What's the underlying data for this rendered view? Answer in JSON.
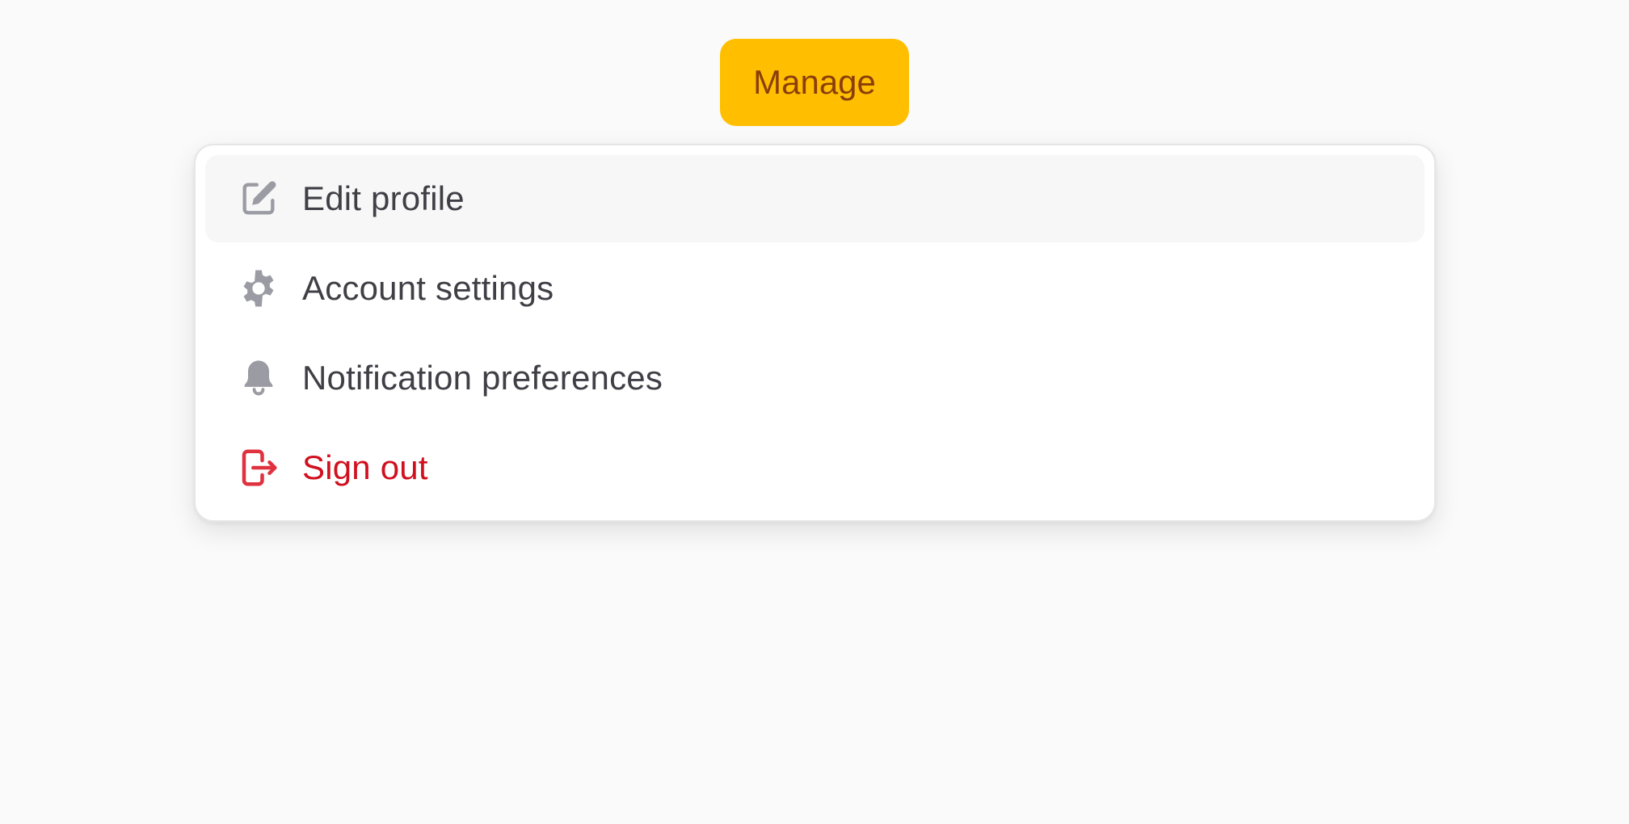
{
  "manage_button": {
    "label": "Manage",
    "color": "#ffbf00",
    "text_color": "#8a3f0a"
  },
  "menu": {
    "items": [
      {
        "label": "Edit profile",
        "icon": "edit-icon",
        "highlighted": true
      },
      {
        "label": "Account settings",
        "icon": "gear-icon",
        "highlighted": false
      },
      {
        "label": "Notification preferences",
        "icon": "bell-icon",
        "highlighted": false
      },
      {
        "label": "Sign out",
        "icon": "sign-out-icon",
        "highlighted": false,
        "danger": true
      }
    ],
    "icon_color": "#9b9ba3",
    "danger_color": "#d0101f"
  }
}
